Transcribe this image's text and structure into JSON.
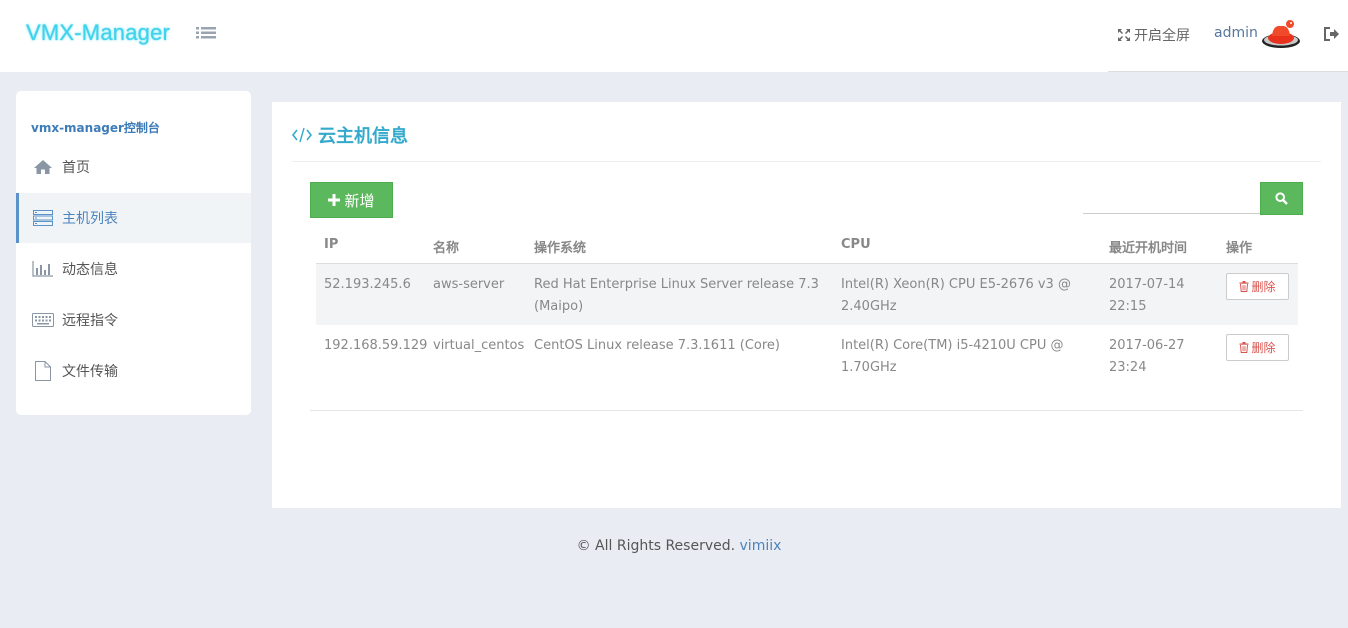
{
  "header": {
    "logo": "VMX-Manager",
    "fullscreen_label": "开启全屏",
    "username": "admin"
  },
  "sidebar": {
    "title": "vmx-manager控制台",
    "items": [
      {
        "label": "首页",
        "icon": "home-icon"
      },
      {
        "label": "主机列表",
        "icon": "server-icon",
        "active": true
      },
      {
        "label": "动态信息",
        "icon": "bar-chart-icon"
      },
      {
        "label": "远程指令",
        "icon": "keyboard-icon"
      },
      {
        "label": "文件传输",
        "icon": "file-icon"
      }
    ]
  },
  "panel": {
    "title": "云主机信息",
    "add_label": "新增",
    "search": {
      "value": "",
      "placeholder": ""
    },
    "columns": [
      "IP",
      "名称",
      "操作系统",
      "CPU",
      "最近开机时间",
      "操作"
    ],
    "rows": [
      {
        "ip": "52.193.245.6",
        "name": "aws-server",
        "os_line1": "Red Hat Enterprise Linux Server release 7.3",
        "os_line2": "(Maipo)",
        "cpu_line1": "Intel(R) Xeon(R) CPU E5-2676 v3 @",
        "cpu_line2": "2.40GHz",
        "boot_date": "2017-07-14",
        "boot_time": "22:15",
        "action": "删除"
      },
      {
        "ip": "192.168.59.129",
        "name": "virtual_centos",
        "os_line1": "CentOS Linux release 7.3.1611 (Core)",
        "os_line2": "",
        "cpu_line1": "Intel(R) Core(TM) i5-4210U CPU @",
        "cpu_line2": "1.70GHz",
        "boot_date": "2017-06-27",
        "boot_time": "23:24",
        "action": "删除"
      }
    ]
  },
  "footer": {
    "text": "© All Rights Reserved.",
    "link": "vimiix"
  },
  "colors": {
    "accent": "#33aacc",
    "success": "#5cb85c",
    "danger": "#d9534f",
    "background": "#e9ecf3"
  }
}
